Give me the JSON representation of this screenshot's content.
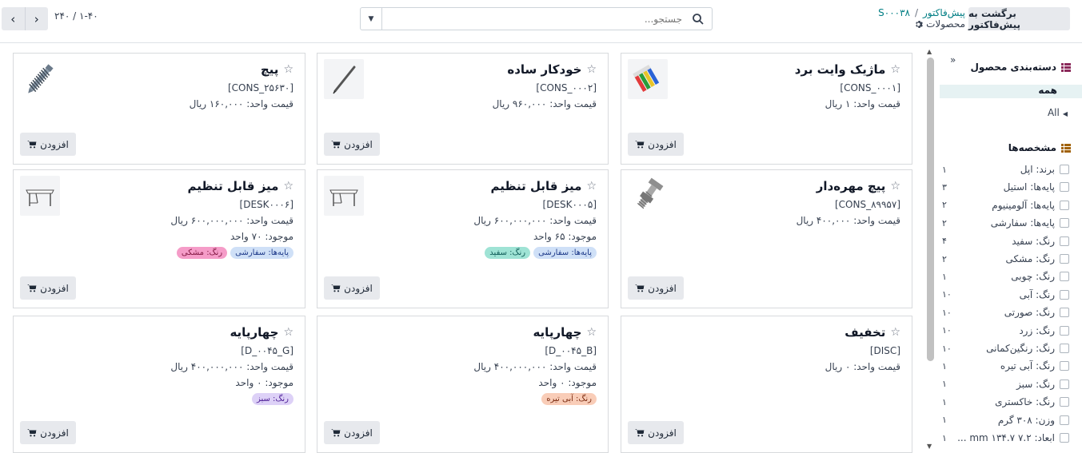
{
  "topbar": {
    "back_button": "برگشت به پیش‌فاکتور",
    "breadcrumb_parent": "پیش‌فاکتور",
    "breadcrumb_current": "S۰۰۰۳۸",
    "breadcrumb_sub": "محصولات",
    "search_placeholder": "جستجو...",
    "pager": "۱-۴۰ / ۲۴۰"
  },
  "cards": [
    {
      "name": "ماژیک وایت برد",
      "code": "[CONS_۰۰۰۱]",
      "price": "قیمت واحد: ۱ ریال",
      "stock": "",
      "tags": [],
      "add": "افزودن",
      "image": "marker-image"
    },
    {
      "name": "خودکار ساده",
      "code": "[CONS_۰۰۰۲]",
      "price": "قیمت واحد: ۹۶۰,۰۰۰ ریال",
      "stock": "",
      "tags": [],
      "add": "افزودن",
      "image": "pen-image"
    },
    {
      "name": "پیچ",
      "code": "[CONS_۲۵۶۳۰]",
      "price": "قیمت واحد: ۱۶۰,۰۰۰ ریال",
      "stock": "",
      "tags": [],
      "add": "افزودن",
      "image": "screw-image"
    },
    {
      "name": "پیچ مهره‌دار",
      "code": "[CONS_۸۹۹۵۷]",
      "price": "قیمت واحد: ۴۰۰,۰۰۰ ریال",
      "stock": "",
      "tags": [],
      "add": "افزودن",
      "image": "bolt-image"
    },
    {
      "name": "میز قابل تنظیم",
      "code": "[DESK۰۰۰۵]",
      "price": "قیمت واحد: ۶۰۰,۰۰۰,۰۰۰ ریال",
      "stock": "موجود: ۶۵ واحد",
      "tags": [
        {
          "text": "پایه‌ها: سفارشی",
          "bg": "#cfe0f7",
          "fg": "#1e3a8a"
        },
        {
          "text": "رنگ: سفید",
          "bg": "#9fe3d5",
          "fg": "#115e59"
        }
      ],
      "add": "افزودن",
      "image": "desk-image"
    },
    {
      "name": "میز قابل تنظیم",
      "code": "[DESK۰۰۰۶]",
      "price": "قیمت واحد: ۶۰۰,۰۰۰,۰۰۰ ریال",
      "stock": "موجود: ۷۰ واحد",
      "tags": [
        {
          "text": "پایه‌ها: سفارشی",
          "bg": "#cfe0f7",
          "fg": "#1e3a8a"
        },
        {
          "text": "رنگ: مشکی",
          "bg": "#f59cc8",
          "fg": "#831843"
        }
      ],
      "add": "افزودن",
      "image": "desk-image"
    },
    {
      "name": "تخفیف",
      "code": "[DISC]",
      "price": "قیمت واحد: ۰ ریال",
      "stock": "",
      "tags": [],
      "add": "افزودن",
      "image": ""
    },
    {
      "name": "چهارپایه",
      "code": "[D_۰۰۴۵_B]",
      "price": "قیمت واحد: ۴۰۰,۰۰۰,۰۰۰ ریال",
      "stock": "موجود: ۰ واحد",
      "tags": [
        {
          "text": "رنگ: آبی تیره",
          "bg": "#f9cdb8",
          "fg": "#7c2d12"
        }
      ],
      "add": "افزودن",
      "image": ""
    },
    {
      "name": "چهارپایه",
      "code": "[D_۰۰۴۵_G]",
      "price": "قیمت واحد: ۴۰۰,۰۰۰,۰۰۰ ریال",
      "stock": "موجود: ۰ واحد",
      "tags": [
        {
          "text": "رنگ: سبز",
          "bg": "#ddd1f7",
          "fg": "#4c1d95"
        }
      ],
      "add": "افزودن",
      "image": ""
    }
  ],
  "sidebar": {
    "category_title": "دسته‌بندی محصول",
    "all_selected": "همه",
    "all_item": "All",
    "attributes_title": "مشخصه‌ها",
    "filters": [
      {
        "label": "برند: اپل",
        "count": "۱"
      },
      {
        "label": "پایه‌ها: استیل",
        "count": "۳"
      },
      {
        "label": "پایه‌ها: آلومینیوم",
        "count": "۲"
      },
      {
        "label": "پایه‌ها: سفارشی",
        "count": "۲"
      },
      {
        "label": "رنگ: سفید",
        "count": "۴"
      },
      {
        "label": "رنگ: مشکی",
        "count": "۲"
      },
      {
        "label": "رنگ: چوبی",
        "count": "۱"
      },
      {
        "label": "رنگ: آبی",
        "count": "۱۰"
      },
      {
        "label": "رنگ: صورتی",
        "count": "۱۰"
      },
      {
        "label": "رنگ: زرد",
        "count": "۱۰"
      },
      {
        "label": "رنگ: رنگین‌کمانی",
        "count": "۱۰"
      },
      {
        "label": "رنگ: آبی تیره",
        "count": "۱"
      },
      {
        "label": "رنگ: سبز",
        "count": "۱"
      },
      {
        "label": "رنگ: خاکستری",
        "count": "۱"
      },
      {
        "label": "وزن: ۳۰۸ گرم",
        "count": "۱"
      },
      {
        "label": "ابعاد: ۷.۲ mm ۱۳۴.۷ ...",
        "count": "۱"
      }
    ]
  }
}
